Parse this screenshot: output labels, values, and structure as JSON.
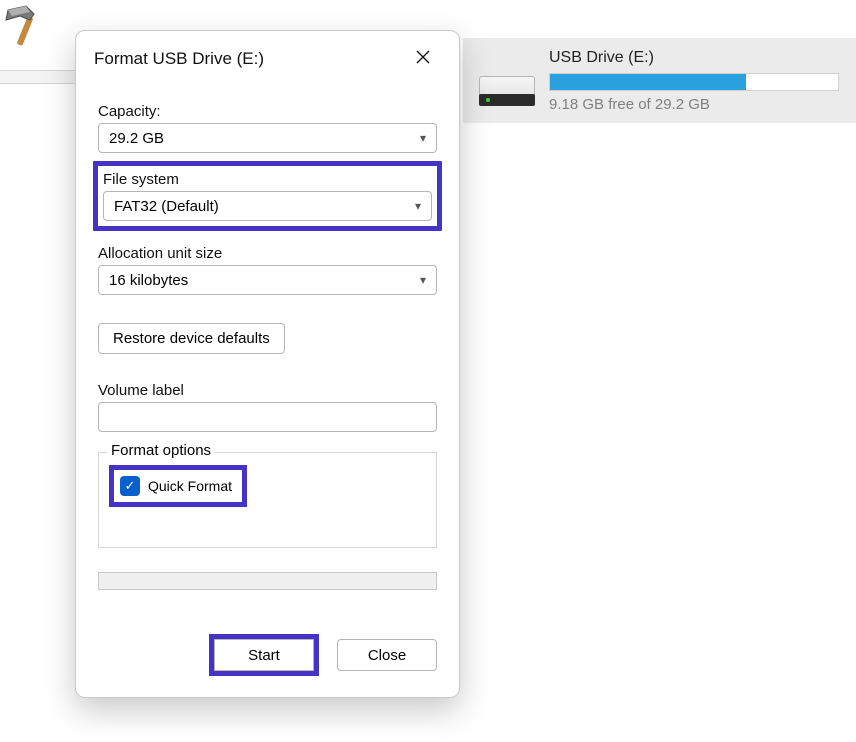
{
  "dialog": {
    "title": "Format USB Drive (E:)",
    "capacity_label": "Capacity:",
    "capacity_value": "29.2 GB",
    "filesystem_label": "File system",
    "filesystem_value": "FAT32 (Default)",
    "allocation_label": "Allocation unit size",
    "allocation_value": "16 kilobytes",
    "restore_label": "Restore device defaults",
    "volume_label": "Volume label",
    "volume_value": "",
    "format_options_label": "Format options",
    "quick_format_label": "Quick Format",
    "quick_format_checked": true,
    "start_label": "Start",
    "close_label": "Close"
  },
  "drive": {
    "title": "USB Drive (E:)",
    "free_text": "9.18 GB free of 29.2 GB",
    "used_percent": 68
  }
}
